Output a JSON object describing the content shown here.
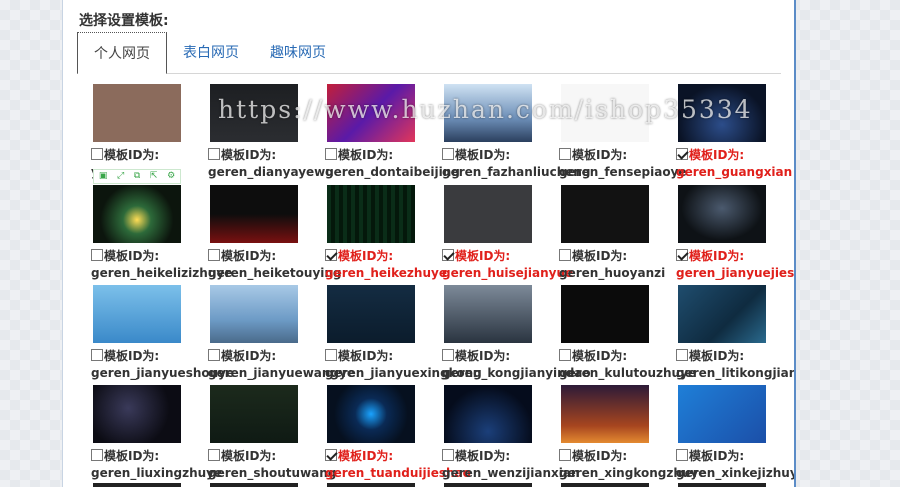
{
  "section_title": "选择设置模板:",
  "tabs": [
    {
      "label": "个人网页",
      "active": true
    },
    {
      "label": "表白网页",
      "active": false
    },
    {
      "label": "趣味网页",
      "active": false
    }
  ],
  "id_prefix": "模板ID为:",
  "watermark": "https://www.huzhan.com/ishop35334",
  "mini_toolbar_icons": [
    "save-icon",
    "expand-icon",
    "copy-icon",
    "share-icon",
    "settings-icon"
  ],
  "templates": [
    {
      "id": "yuange",
      "checked": false,
      "theme": "monkey"
    },
    {
      "id": "geren_dianyayewu",
      "checked": false,
      "theme": "dark-grid"
    },
    {
      "id": "geren_dontaibeijing",
      "checked": false,
      "theme": "anime"
    },
    {
      "id": "geren_fazhanliucheng",
      "checked": false,
      "theme": "sky"
    },
    {
      "id": "geren_fensepiaoye",
      "checked": false,
      "theme": "white"
    },
    {
      "id": "geren_guangxian",
      "checked": true,
      "theme": "blue-night"
    },
    {
      "id": "geren_heikelizizhuye",
      "checked": false,
      "theme": "particles"
    },
    {
      "id": "geren_heiketouying",
      "checked": false,
      "theme": "dark-red"
    },
    {
      "id": "geren_heikezhuye",
      "checked": true,
      "theme": "matrix"
    },
    {
      "id": "geren_huisejianyue",
      "checked": true,
      "theme": "gray"
    },
    {
      "id": "geren_huoyanzi",
      "checked": false,
      "theme": "fire"
    },
    {
      "id": "geren_jianyuejieshao",
      "checked": true,
      "theme": "dark-ring"
    },
    {
      "id": "geren_jianyueshouye",
      "checked": false,
      "theme": "light-blue"
    },
    {
      "id": "geren_jianyuewangye",
      "checked": false,
      "theme": "profile"
    },
    {
      "id": "geren_jianyuexingkong",
      "checked": false,
      "theme": "starry"
    },
    {
      "id": "geren_kongjianyindao",
      "checked": false,
      "theme": "city"
    },
    {
      "id": "geren_kulutouzhuye",
      "checked": false,
      "theme": "skull"
    },
    {
      "id": "geren_litikongjian",
      "checked": false,
      "theme": "blue-poly"
    },
    {
      "id": "geren_liuxingzhuye",
      "checked": false,
      "theme": "meteor"
    },
    {
      "id": "geren_shoutuwang",
      "checked": false,
      "theme": "green-dark"
    },
    {
      "id": "geren_tuanduijieshao",
      "checked": true,
      "theme": "glow-blue"
    },
    {
      "id": "geren_wenzijianxian",
      "checked": false,
      "theme": "orbit"
    },
    {
      "id": "geren_xingkongzhuye",
      "checked": false,
      "theme": "sunset"
    },
    {
      "id": "geren_xinkejizhuye",
      "checked": false,
      "theme": "tech-blue"
    }
  ]
}
